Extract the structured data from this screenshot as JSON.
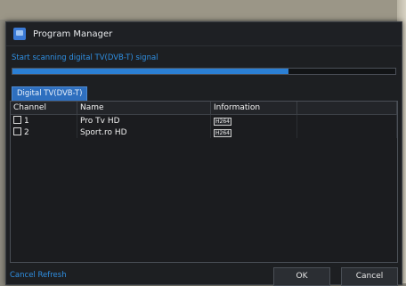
{
  "window": {
    "title": "Program Manager"
  },
  "scan": {
    "status_text": "Start scanning digital TV(DVB-T) signal",
    "progress": 0.72
  },
  "tabs": [
    {
      "label": "Digital TV(DVB-T)",
      "selected": true
    }
  ],
  "table": {
    "columns": [
      "Channel",
      "Name",
      "Information",
      ""
    ],
    "rows": [
      {
        "channel": "1",
        "name": "Pro Tv HD",
        "info": "H264",
        "checked": false
      },
      {
        "channel": "2",
        "name": "Sport.ro HD",
        "info": "H264",
        "checked": false
      }
    ]
  },
  "footer": {
    "cancel_refresh": "Cancel Refresh",
    "ok_label": "OK",
    "cancel_label": "Cancel"
  },
  "colors": {
    "accent": "#2f8fe2",
    "window_bg": "#1d1f22",
    "tab_bg": "#2e6fbf"
  }
}
